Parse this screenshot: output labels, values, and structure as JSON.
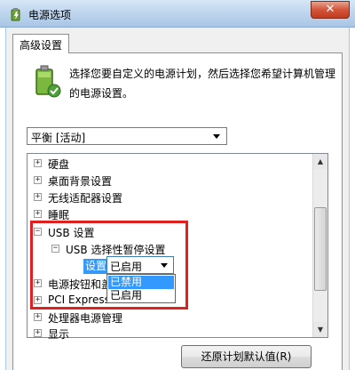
{
  "window": {
    "title": "电源选项",
    "close_glyph": "✕"
  },
  "tabs": [
    {
      "label": "高级设置"
    }
  ],
  "description": "选择您要自定义的电源计划，然后选择您希望计算机管理的电源设置。",
  "plan": {
    "selected": "平衡 [活动]"
  },
  "tree": {
    "items": [
      {
        "label": "硬盘",
        "state": "+"
      },
      {
        "label": "桌面背景设置",
        "state": "+"
      },
      {
        "label": "无线适配器设置",
        "state": "+"
      },
      {
        "label": "睡眠",
        "state": "+"
      },
      {
        "label": "USB 设置",
        "state": "−"
      },
      {
        "label": "USB 选择性暂停设置",
        "state": "−"
      },
      {
        "label": "电源按钮和盖",
        "state": "+"
      },
      {
        "label": "PCI Express",
        "state": "+"
      },
      {
        "label": "处理器电源管理",
        "state": "+"
      },
      {
        "label": "显示",
        "state": "+"
      }
    ],
    "setting_label": "设置:",
    "setting_value": "已启用",
    "dropdown_options": [
      {
        "label": "已禁用",
        "selected": true
      },
      {
        "label": "已启用",
        "selected": false
      }
    ]
  },
  "buttons": {
    "restore_defaults": "还原计划默认值(R)"
  },
  "colors": {
    "highlight": "#e0201f",
    "selection": "#3399ff"
  }
}
